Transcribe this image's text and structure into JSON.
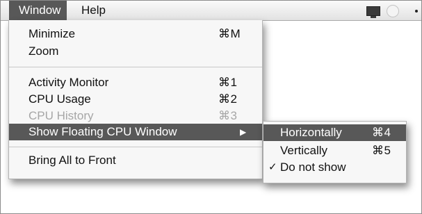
{
  "menubar": {
    "items": [
      {
        "label": "Window"
      },
      {
        "label": "Help"
      }
    ]
  },
  "status_icons": [
    "cpu-monitor-icon",
    "spotlight-icon"
  ],
  "window_menu": {
    "items": [
      {
        "label": "Minimize",
        "shortcut": "⌘M"
      },
      {
        "label": "Zoom",
        "shortcut": ""
      },
      {
        "label": "Activity Monitor",
        "shortcut": "⌘1"
      },
      {
        "label": "CPU Usage",
        "shortcut": "⌘2"
      },
      {
        "label": "CPU History",
        "shortcut": "⌘3",
        "enabled": false
      },
      {
        "label": "Show Floating CPU Window",
        "submenu_arrow": "▶",
        "highlighted": true
      },
      {
        "label": "Bring All to Front",
        "shortcut": ""
      }
    ]
  },
  "floating_submenu": {
    "items": [
      {
        "label": "Horizontally",
        "shortcut": "⌘4",
        "highlighted": true
      },
      {
        "label": "Vertically",
        "shortcut": "⌘5"
      },
      {
        "label": "Do not show",
        "checked": true,
        "check_mark": "✓"
      }
    ]
  },
  "colors": {
    "highlight": "#585858",
    "menu_background": "#f7f7f7",
    "disabled_text": "#a6a6a6"
  }
}
